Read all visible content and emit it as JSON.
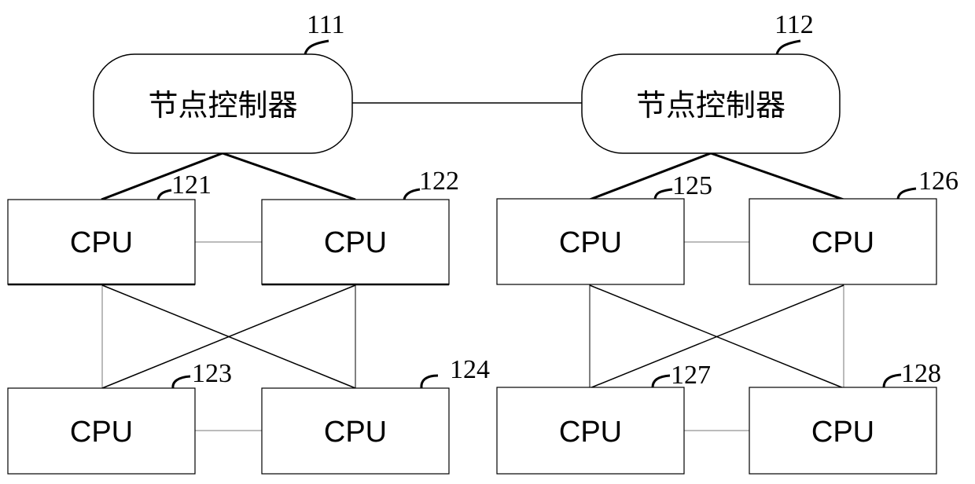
{
  "diagram": {
    "controllers": [
      {
        "id": "111",
        "label": "节点控制器"
      },
      {
        "id": "112",
        "label": "节点控制器"
      }
    ],
    "cpus": [
      {
        "id": "121",
        "label": "CPU",
        "controller": "111"
      },
      {
        "id": "122",
        "label": "CPU",
        "controller": "111"
      },
      {
        "id": "123",
        "label": "CPU",
        "controller": "111"
      },
      {
        "id": "124",
        "label": "CPU",
        "controller": "111"
      },
      {
        "id": "125",
        "label": "CPU",
        "controller": "112"
      },
      {
        "id": "126",
        "label": "CPU",
        "controller": "112"
      },
      {
        "id": "127",
        "label": "CPU",
        "controller": "112"
      },
      {
        "id": "128",
        "label": "CPU",
        "controller": "112"
      }
    ],
    "links": [
      [
        "111",
        "112"
      ],
      [
        "111",
        "121"
      ],
      [
        "111",
        "122"
      ],
      [
        "121",
        "122"
      ],
      [
        "123",
        "124"
      ],
      [
        "121",
        "123"
      ],
      [
        "122",
        "124"
      ],
      [
        "121",
        "124"
      ],
      [
        "122",
        "123"
      ],
      [
        "112",
        "125"
      ],
      [
        "112",
        "126"
      ],
      [
        "125",
        "126"
      ],
      [
        "127",
        "128"
      ],
      [
        "125",
        "127"
      ],
      [
        "126",
        "128"
      ],
      [
        "125",
        "128"
      ],
      [
        "126",
        "127"
      ]
    ]
  }
}
